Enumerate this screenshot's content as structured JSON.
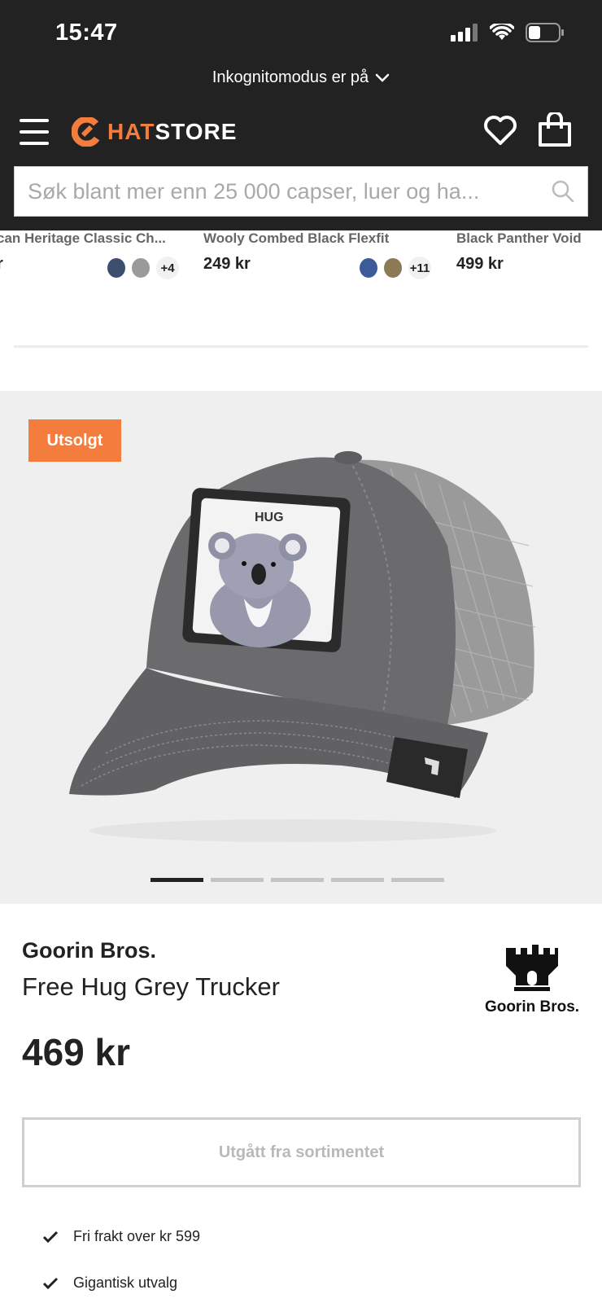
{
  "status_bar": {
    "time": "15:47"
  },
  "incognito": {
    "label": "Inkognitomodus er på"
  },
  "header": {
    "logo_hat": "HAT",
    "logo_store": "STORE",
    "search_placeholder": "Søk blant mer enn 25 000 capser, luer og ha..."
  },
  "recommended": [
    {
      "name": "can Heritage Classic Ch...",
      "price": "r",
      "more_colors": "+4"
    },
    {
      "name": "Wooly Combed Black Flexfit",
      "price": "249 kr",
      "more_colors": "+11"
    },
    {
      "name": "Black Panther Void",
      "price": "499 kr"
    }
  ],
  "gallery": {
    "badge": "Utsolgt",
    "patch_text": "HUG",
    "image_count": 5,
    "active_index": 0
  },
  "product": {
    "brand": "Goorin Bros.",
    "name": "Free Hug Grey Trucker",
    "price": "469 kr",
    "brand_logo_text": "Goorin Bros.",
    "button_label": "Utgått fra sortimentet"
  },
  "usps": [
    {
      "text": "Fri frakt over kr 599"
    },
    {
      "text": "Gigantisk utvalg"
    }
  ],
  "colors": {
    "accent": "#f47c3c",
    "dark": "#222222"
  }
}
